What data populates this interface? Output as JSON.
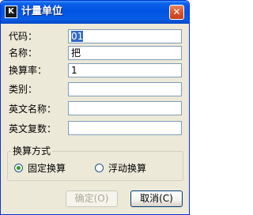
{
  "window": {
    "title": "计量单位",
    "app_icon_text": "K",
    "close_glyph": "✕"
  },
  "form": {
    "code": {
      "label": "代码：",
      "value": "01"
    },
    "name": {
      "label": "名称：",
      "value": "把"
    },
    "rate": {
      "label": "换算率：",
      "value": "1"
    },
    "category": {
      "label": "类别：",
      "value": ""
    },
    "en_name": {
      "label": "英文名称：",
      "value": ""
    },
    "en_plural": {
      "label": "英文复数：",
      "value": ""
    }
  },
  "conversion": {
    "title": "换算方式",
    "options": [
      {
        "label": "固定换算",
        "selected": true
      },
      {
        "label": "浮动换算",
        "selected": false
      }
    ]
  },
  "buttons": {
    "ok": "确定(O)",
    "cancel": "取消(C)"
  },
  "colors": {
    "titlebar": "#0054e3",
    "dialog_bg": "#ece9d8",
    "selection": "#316ac5",
    "close_button": "#d9552b"
  }
}
